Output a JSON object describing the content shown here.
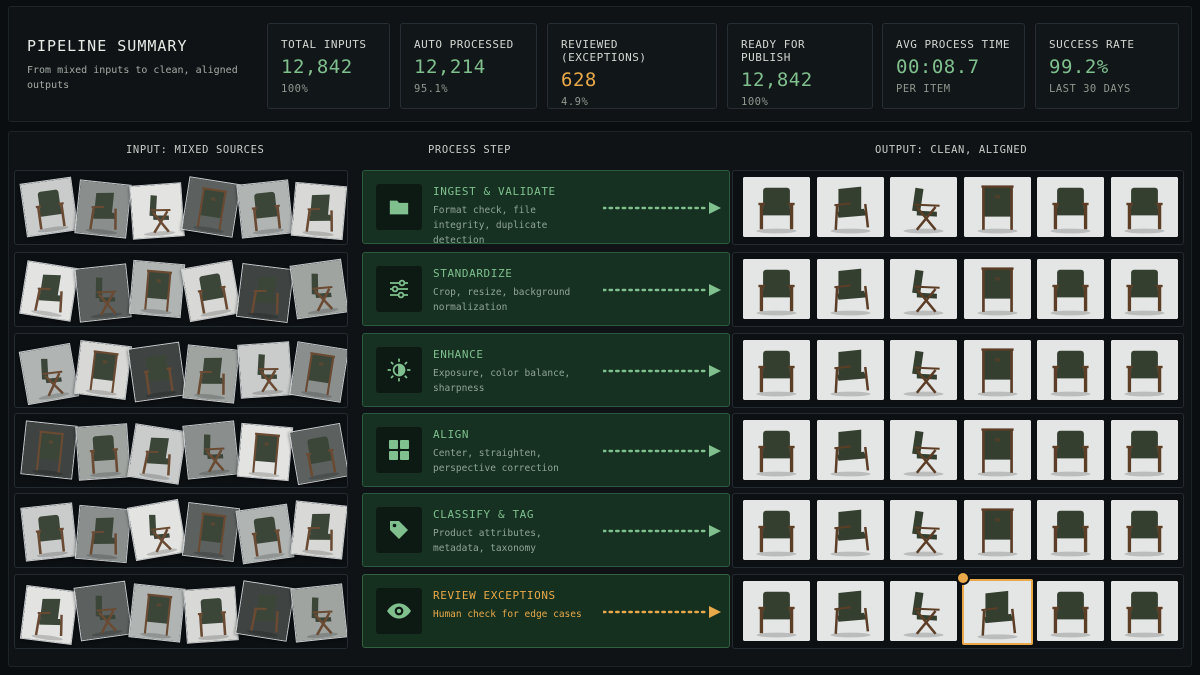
{
  "header": {
    "title": "PIPELINE SUMMARY",
    "subtitle": "From mixed inputs to clean, aligned outputs"
  },
  "stats": [
    {
      "label": "TOTAL INPUTS",
      "value": "12,842",
      "sub": "100%"
    },
    {
      "label": "AUTO PROCESSED",
      "value": "12,214",
      "sub": "95.1%"
    },
    {
      "label": "REVIEWED (EXCEPTIONS)",
      "value": "628",
      "sub": "4.9%"
    },
    {
      "label": "READY FOR PUBLISH",
      "value": "12,842",
      "sub": "100%"
    },
    {
      "label": "AVG PROCESS TIME",
      "value": "00:08.7",
      "sub": "PER ITEM"
    },
    {
      "label": "SUCCESS RATE",
      "value": "99.2%",
      "sub": "LAST 30 DAYS"
    }
  ],
  "columns": {
    "input": "INPUT: MIXED SOURCES",
    "process": "PROCESS STEP",
    "output": "OUTPUT: CLEAN, ALIGNED"
  },
  "steps": [
    {
      "title": "INGEST & VALIDATE",
      "desc": "Format check, file integrity, duplicate detection",
      "icon": "folder-icon"
    },
    {
      "title": "STANDARDIZE",
      "desc": "Crop, resize, background normalization",
      "icon": "sliders-icon"
    },
    {
      "title": "ENHANCE",
      "desc": "Exposure, color balance, sharpness",
      "icon": "brightness-icon"
    },
    {
      "title": "ALIGN",
      "desc": "Center, straighten, perspective correction",
      "icon": "grid-icon"
    },
    {
      "title": "CLASSIFY & TAG",
      "desc": "Product attributes, metadata, taxonomy",
      "icon": "tag-icon"
    },
    {
      "title": "REVIEW EXCEPTIONS",
      "desc": "Human check for edge cases",
      "icon": "eye-icon"
    }
  ],
  "colors": {
    "accent_green": "#7fc08e",
    "accent_amber": "#e9a94a",
    "card_bg": "#163022"
  }
}
